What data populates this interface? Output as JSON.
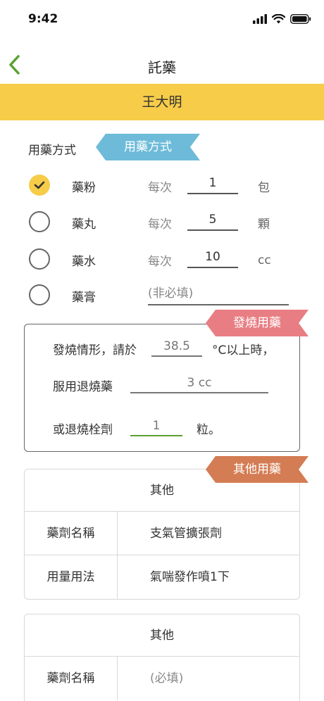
{
  "status_bar": {
    "time": "9:42"
  },
  "nav": {
    "title": "託藥"
  },
  "patient": {
    "name": "王大明"
  },
  "medication": {
    "section_label": "用藥方式",
    "ribbon": "用藥方式",
    "items": [
      {
        "name": "藥粉",
        "per": "每次",
        "qty": "1",
        "unit": "包",
        "checked": true
      },
      {
        "name": "藥丸",
        "per": "每次",
        "qty": "5",
        "unit": "顆",
        "checked": false
      },
      {
        "name": "藥水",
        "per": "每次",
        "qty": "10",
        "unit": "cc",
        "checked": false
      },
      {
        "name": "藥膏",
        "placeholder": "(非必填)",
        "checked": false
      }
    ]
  },
  "fever": {
    "ribbon": "發燒用藥",
    "line1_prefix": "發燒情形，請於",
    "temperature": "38.5",
    "line1_suffix": "°C以上時，",
    "line2_prefix": "服用退燒藥",
    "dose": "3 cc",
    "line3_prefix": "或退燒栓劑",
    "suppository": "1",
    "line3_suffix": "粒。"
  },
  "other": {
    "ribbon": "其他用藥",
    "cards": [
      {
        "title": "其他",
        "rows": [
          {
            "label": "藥劑名稱",
            "value": "支氣管擴張劑"
          },
          {
            "label": "用量用法",
            "value": "氣喘發作噴1下"
          }
        ]
      },
      {
        "title": "其他",
        "rows": [
          {
            "label": "藥劑名稱",
            "placeholder": "(必填)"
          }
        ]
      }
    ]
  },
  "colors": {
    "accent_yellow": "#f6cc49",
    "back_green": "#5aa032",
    "ribbon_blue": "#6dbbd9",
    "ribbon_pink": "#e87e83",
    "ribbon_orange": "#d47c53"
  }
}
